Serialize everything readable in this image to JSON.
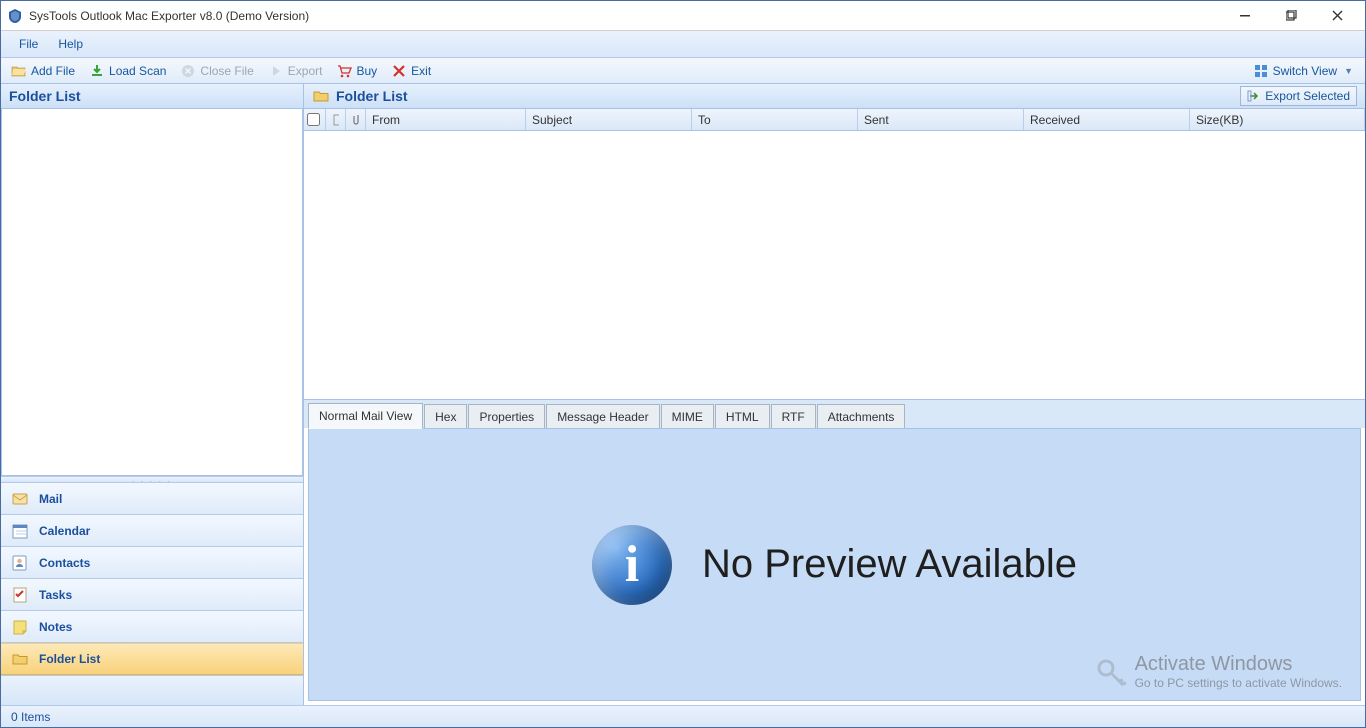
{
  "window": {
    "title": "SysTools Outlook Mac Exporter v8.0 (Demo Version)"
  },
  "menu": {
    "file": "File",
    "help": "Help"
  },
  "toolbar": {
    "add_file": "Add File",
    "load_scan": "Load Scan",
    "close_file": "Close File",
    "export": "Export",
    "buy": "Buy",
    "exit": "Exit",
    "switch_view": "Switch View"
  },
  "left": {
    "header": "Folder List",
    "nav": {
      "mail": "Mail",
      "calendar": "Calendar",
      "contacts": "Contacts",
      "tasks": "Tasks",
      "notes": "Notes",
      "folder_list": "Folder List"
    }
  },
  "content": {
    "header": "Folder List",
    "export_selected": "Export Selected",
    "columns": {
      "from": "From",
      "subject": "Subject",
      "to": "To",
      "sent": "Sent",
      "received": "Received",
      "size": "Size(KB)"
    }
  },
  "tabs": {
    "normal": "Normal Mail View",
    "hex": "Hex",
    "properties": "Properties",
    "header": "Message Header",
    "mime": "MIME",
    "html": "HTML",
    "rtf": "RTF",
    "attachments": "Attachments"
  },
  "preview": {
    "no_preview": "No Preview Available"
  },
  "watermark": {
    "line1": "Activate Windows",
    "line2": "Go to PC settings to activate Windows."
  },
  "status": {
    "items": "0 Items"
  }
}
